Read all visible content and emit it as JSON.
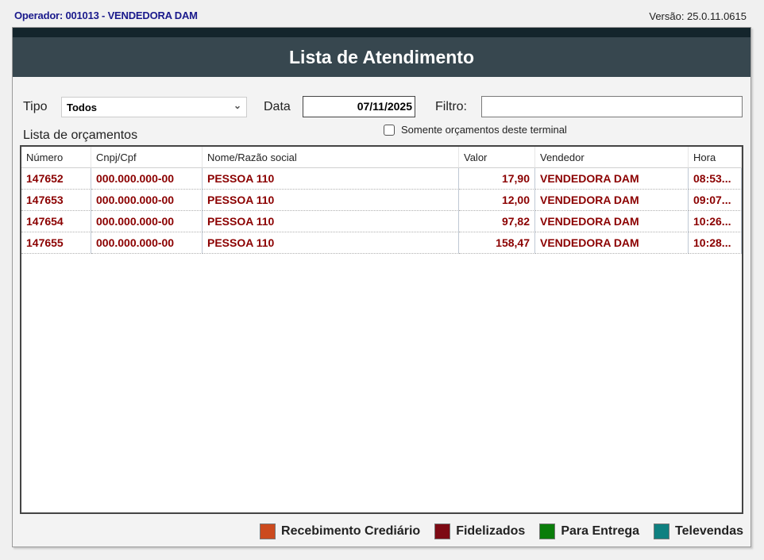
{
  "header": {
    "operator": "Operador: 001013 - VENDEDORA DAM",
    "version": "Versão: 25.0.11.0615"
  },
  "title": "Lista de Atendimento",
  "filters": {
    "tipo_label": "Tipo",
    "tipo_value": "Todos",
    "data_label": "Data",
    "data_value": "07/11/2025",
    "filtro_label": "Filtro:",
    "filtro_value": "",
    "checkbox_label": "Somente orçamentos deste terminal",
    "checkbox_checked": false
  },
  "list_label": "Lista de orçamentos",
  "table": {
    "columns": [
      "Número",
      "Cnpj/Cpf",
      "Nome/Razão social",
      "Valor",
      "Vendedor",
      "Hora"
    ],
    "rows": [
      [
        "147652",
        "000.000.000-00",
        "PESSOA 110",
        "17,90",
        "VENDEDORA DAM",
        "08:53..."
      ],
      [
        "147653",
        "000.000.000-00",
        "PESSOA 110",
        "12,00",
        "VENDEDORA DAM",
        "09:07..."
      ],
      [
        "147654",
        "000.000.000-00",
        "PESSOA 110",
        "97,82",
        "VENDEDORA DAM",
        "10:26..."
      ],
      [
        "147655",
        "000.000.000-00",
        "PESSOA 110",
        "158,47",
        "VENDEDORA DAM",
        "10:28..."
      ]
    ]
  },
  "legend": [
    {
      "label": "Recebimento Crediário",
      "color": "#cc4a1e"
    },
    {
      "label": "Fidelizados",
      "color": "#7d0a14"
    },
    {
      "label": "Para Entrega",
      "color": "#0a7d0a"
    },
    {
      "label": "Televendas",
      "color": "#0f8080"
    }
  ]
}
